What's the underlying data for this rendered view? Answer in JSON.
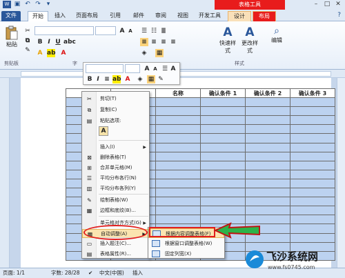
{
  "window": {
    "contextual_title": "表格工具"
  },
  "tabs": [
    "文件",
    "开始",
    "插入",
    "页面布局",
    "引用",
    "邮件",
    "审阅",
    "视图",
    "开发工具",
    "设计",
    "布局"
  ],
  "ribbon": {
    "paste_label": "粘贴",
    "clipboard_label": "剪贴板",
    "font_group_label": "字",
    "styles_group_label": "样式",
    "quick_styles_label": "快速样式",
    "change_styles_label": "更改样式",
    "editing_label": "编辑"
  },
  "table": {
    "headers": [
      "",
      "",
      "名称",
      "确认条件 1",
      "确认条件 2",
      "确认条件 3"
    ],
    "row_count": 18
  },
  "context_menu": {
    "items": [
      {
        "label": "剪切(T)",
        "icon": "cut-icon"
      },
      {
        "label": "复制(C)",
        "icon": "copy-icon"
      },
      {
        "label": "粘贴选项:",
        "icon": "paste-icon"
      },
      {
        "label": "插入(I)",
        "icon": "",
        "submenu": true
      },
      {
        "label": "删除表格(T)",
        "icon": "delete-table-icon"
      },
      {
        "label": "合并单元格(M)",
        "icon": "merge-cells-icon"
      },
      {
        "label": "平均分布各行(N)",
        "icon": "distribute-rows-icon"
      },
      {
        "label": "平均分布各列(Y)",
        "icon": "distribute-columns-icon"
      },
      {
        "label": "绘制表格(W)",
        "icon": "draw-table-icon"
      },
      {
        "label": "边框和底纹(B)...",
        "icon": "borders-icon"
      },
      {
        "label": "单元格对齐方式(G)",
        "icon": "",
        "submenu": true
      },
      {
        "label": "自动调整(A)",
        "icon": "autofit-icon",
        "submenu": true,
        "highlighted": true
      },
      {
        "label": "插入题注(C)...",
        "icon": "caption-icon"
      },
      {
        "label": "表格属性(R)...",
        "icon": "table-properties-icon"
      }
    ]
  },
  "submenu": {
    "items": [
      {
        "label": "根据内容调整表格(F)",
        "highlighted": true
      },
      {
        "label": "根据窗口调整表格(W)",
        "highlighted": false
      },
      {
        "label": "固定列宽(X)",
        "highlighted": false
      }
    ]
  },
  "statusbar": {
    "page": "页面: 1/1",
    "words": "字数: 28/28",
    "language": "中文(中国)",
    "mode": "插入"
  },
  "watermark": {
    "site": "飞沙系统网",
    "url": "www.fs0745.com"
  },
  "colors": {
    "accent": "#2a579a",
    "contextual": "#e81c1c",
    "table_fill": "#bcd2f0",
    "highlight": "#fbe4b0"
  }
}
